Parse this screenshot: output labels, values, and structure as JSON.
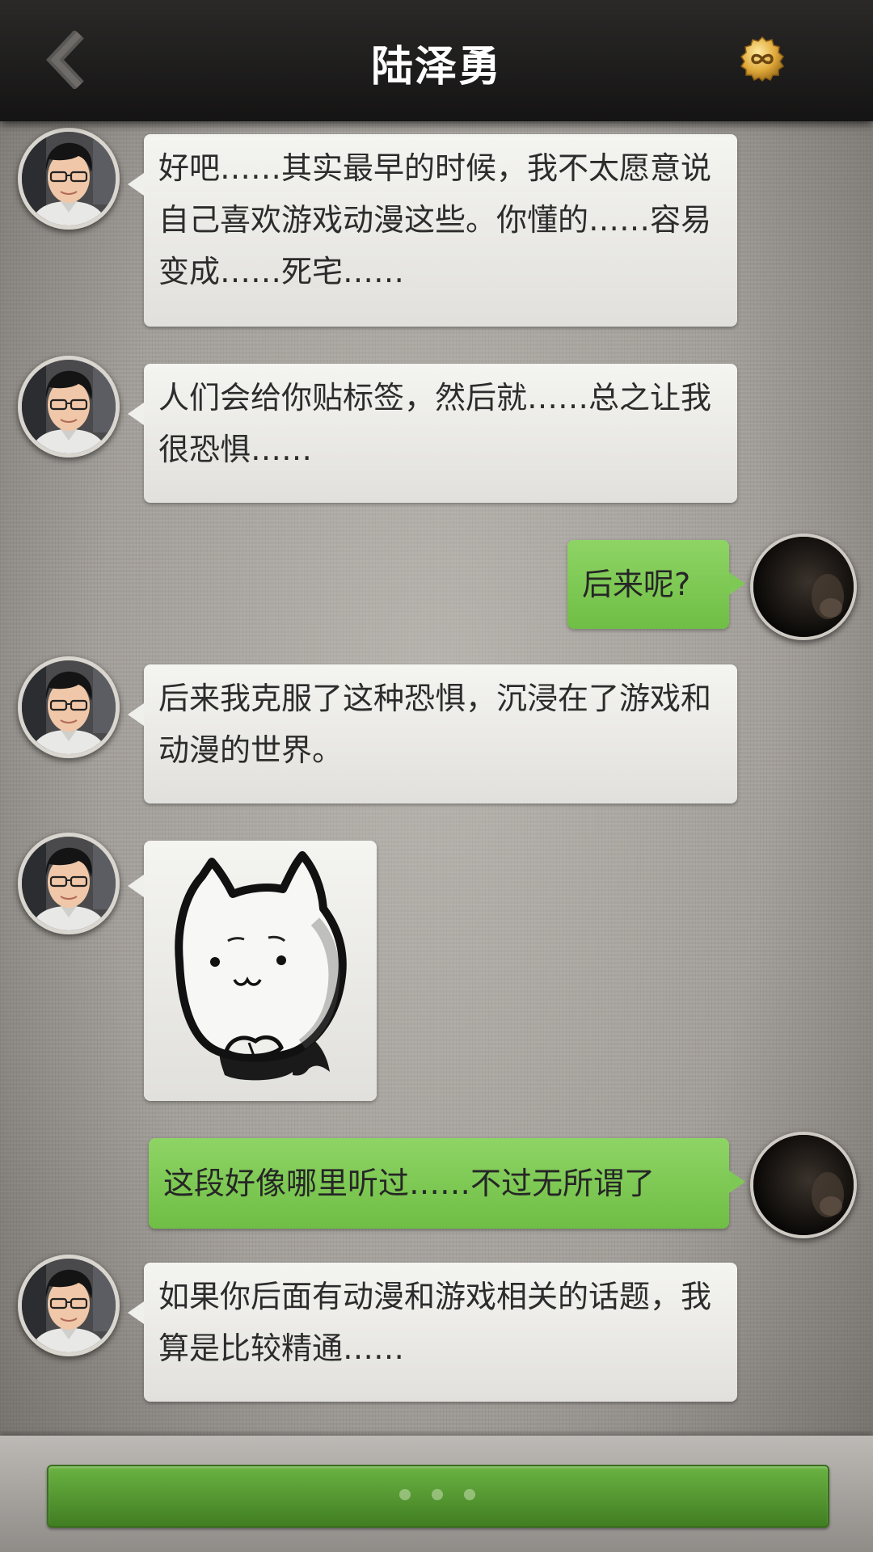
{
  "header": {
    "title": "陆泽勇",
    "back_icon": "chevron-left-icon",
    "coin_icon": "infinity-coin-icon"
  },
  "messages": [
    {
      "side": "left",
      "text": "好吧……其实最早的时候，我不太愿意说自己喜欢游戏动漫这些。你懂的……容易变成……死宅……"
    },
    {
      "side": "left",
      "text": "人们会给你贴标签，然后就……总之让我很恐惧……"
    },
    {
      "side": "right",
      "text": "后来呢?"
    },
    {
      "side": "left",
      "text": "后来我克服了这种恐惧，沉浸在了游戏和动漫的世界。"
    },
    {
      "side": "left",
      "type": "sticker",
      "sticker": "cat-sticker"
    },
    {
      "side": "right",
      "text": "这段好像哪里听过……不过无所谓了"
    },
    {
      "side": "left",
      "text": "如果你后面有动漫和游戏相关的话题，我算是比较精通……"
    }
  ],
  "input": {
    "icon": "ellipsis-dots-icon"
  },
  "colors": {
    "right_bubble": "#7ec955",
    "left_bubble": "#efefec",
    "header_bg": "#1c1b1a",
    "input_bar": "#5a9e34"
  }
}
